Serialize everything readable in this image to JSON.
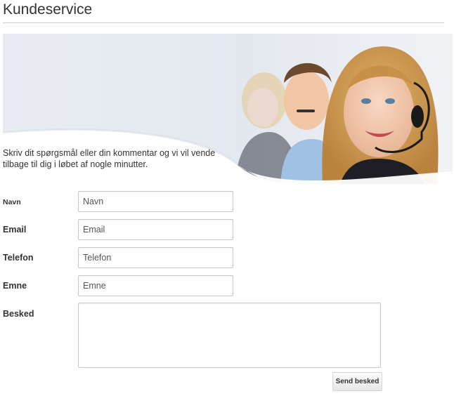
{
  "page": {
    "title": "Kundeservice",
    "intro": "Skriv dit spørgsmål eller din kommentar og vi vil vende tilbage til dig i løbet af nogle minutter."
  },
  "banner": {
    "description_icon": "customer-service-agents-photo"
  },
  "form": {
    "name": {
      "label": "Navn",
      "placeholder": "Navn"
    },
    "email": {
      "label": "Email",
      "placeholder": "Email"
    },
    "phone": {
      "label": "Telefon",
      "placeholder": "Telefon"
    },
    "subject": {
      "label": "Emne",
      "placeholder": "Emne"
    },
    "message": {
      "label": "Besked"
    },
    "submit_label": "Send besked"
  },
  "colors": {
    "banner_bg": "#e6ebf2",
    "accent_wave": "#dde3ea"
  }
}
